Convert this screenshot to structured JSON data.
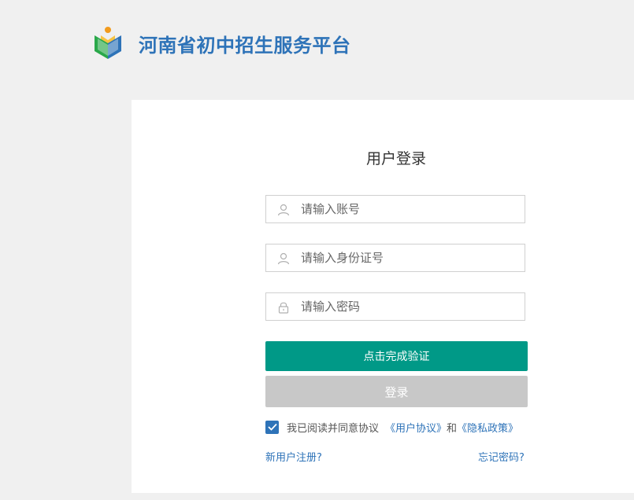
{
  "header": {
    "title": "河南省初中招生服务平台"
  },
  "login": {
    "title": "用户登录",
    "account_placeholder": "请输入账号",
    "id_card_placeholder": "请输入身份证号",
    "password_placeholder": "请输入密码",
    "verify_label": "点击完成验证",
    "login_label": "登录",
    "agreement": {
      "text": "我已阅读并同意协议",
      "user_agreement": "《用户协议》",
      "and": "和",
      "privacy_policy": "《隐私政策》",
      "checked": true
    },
    "register_link": "新用户注册?",
    "forgot_link": "忘记密码?"
  },
  "colors": {
    "brand": "#2e73b8",
    "verify_button": "#009987",
    "login_button_disabled": "#c8c8c8"
  },
  "icons": [
    "book-logo-icon",
    "user-icon",
    "id-card-user-icon",
    "lock-icon",
    "check-icon"
  ]
}
